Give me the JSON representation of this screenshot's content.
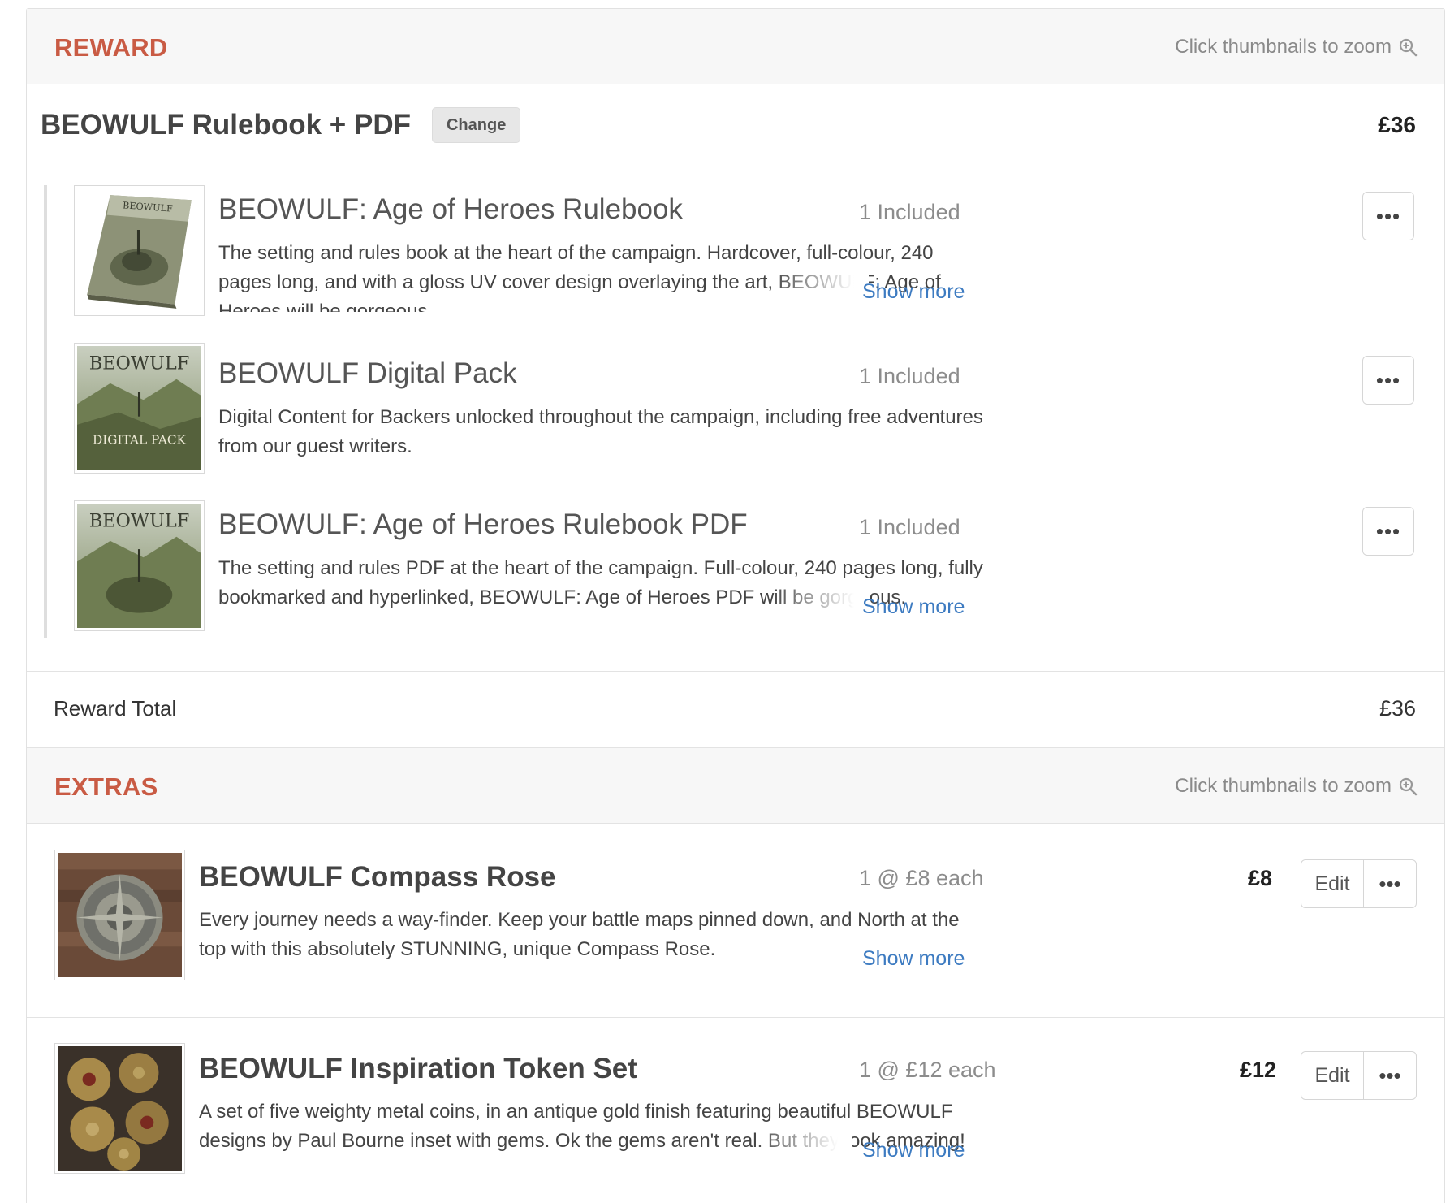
{
  "reward": {
    "section_title": "REWARD",
    "zoom_hint": "Click thumbnails to zoom",
    "title": "BEOWULF Rulebook + PDF",
    "change_label": "Change",
    "price": "£36",
    "items": [
      {
        "title": "BEOWULF: Age of Heroes Rulebook",
        "qty": "1 Included",
        "desc": "The setting and rules book at the heart of the campaign. Hardcover, full-colour, 240 pages long, and with a gloss UV cover design overlaying the art, BEOWULF: Age of Heroes will be gorgeous.",
        "show_more": "Show more"
      },
      {
        "title": "BEOWULF Digital Pack",
        "qty": "1 Included",
        "desc": "Digital Content for Backers unlocked throughout the campaign, including free adventures from our guest writers."
      },
      {
        "title": "BEOWULF: Age of Heroes Rulebook PDF",
        "qty": "1 Included",
        "desc": "The setting and rules PDF at the heart of the campaign. Full-colour, 240 pages long, fully bookmarked and hyperlinked, BEOWULF: Age of Heroes PDF will be gorgeous.",
        "show_more": "Show more"
      }
    ],
    "total_label": "Reward Total",
    "total_value": "£36"
  },
  "extras": {
    "section_title": "EXTRAS",
    "zoom_hint": "Click thumbnails to zoom",
    "items": [
      {
        "title": "BEOWULF Compass Rose",
        "qty": "1 @ £8 each",
        "price": "£8",
        "desc": "Every journey needs a way-finder. Keep your battle maps pinned down, and North at the top with this absolutely STUNNING, unique Compass Rose.",
        "show_more": "Show more",
        "edit_label": "Edit"
      },
      {
        "title": "BEOWULF Inspiration Token Set",
        "qty": "1 @ £12 each",
        "price": "£12",
        "desc": "A set of five weighty metal coins, in an antique gold finish featuring beautiful BEOWULF designs by Paul Bourne inset with gems. Ok the gems aren't real. But they look amazing!",
        "show_more": "Show more",
        "edit_label": "Edit"
      }
    ]
  },
  "icons": {
    "zoom": "zoom-in-icon",
    "more": "ellipsis-icon"
  },
  "thumb_text": {
    "book_cover": "BEOWULF",
    "digital_pack": "DIGITAL PACK"
  },
  "colors": {
    "section_title": "#c95b44",
    "link": "#3d7bc1",
    "header_bg": "#f7f7f7"
  }
}
